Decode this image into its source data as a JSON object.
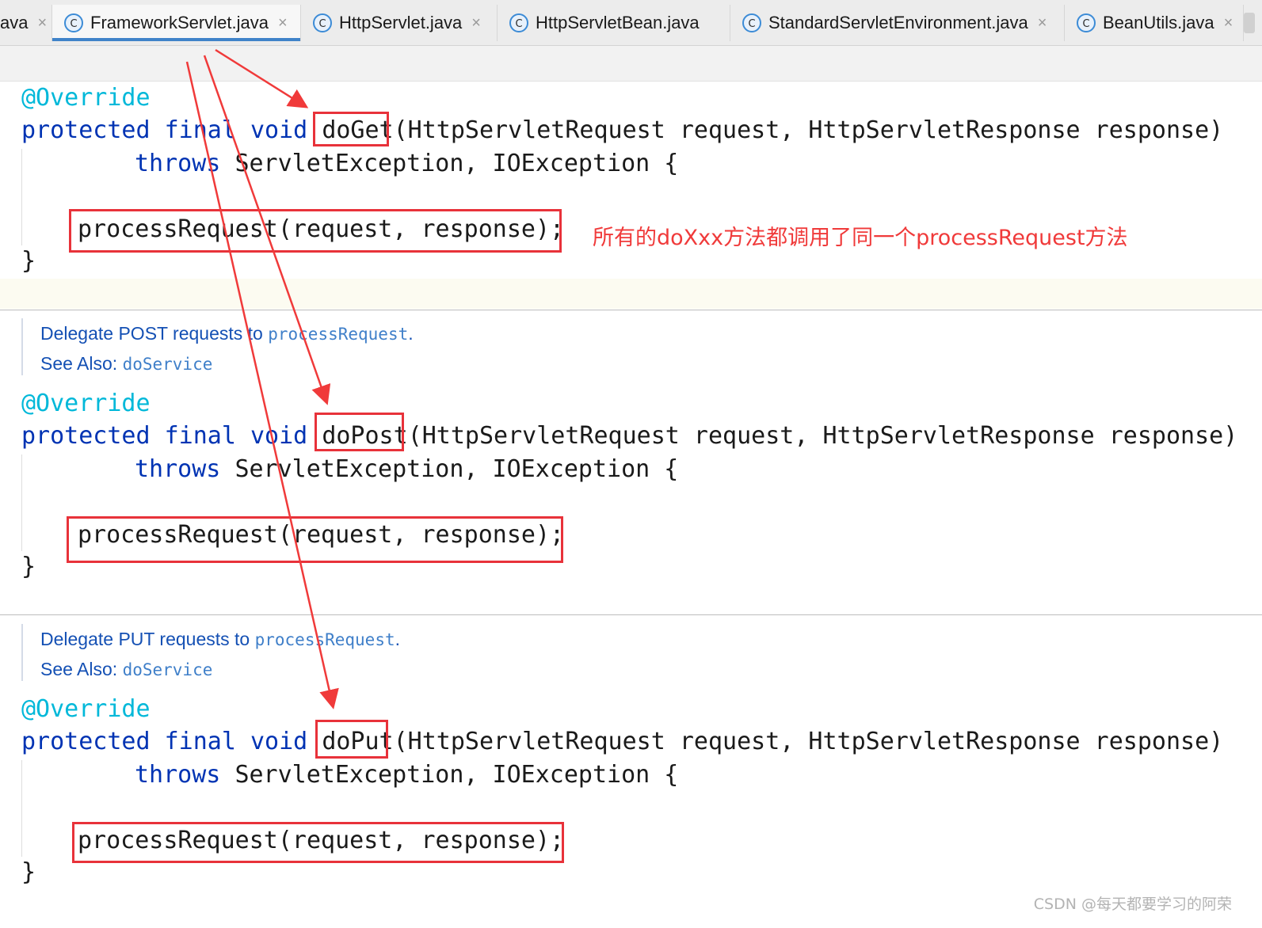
{
  "tabs": [
    {
      "label": "ava",
      "active": false,
      "partial": true
    },
    {
      "label": "FrameworkServlet.java",
      "active": true
    },
    {
      "label": "HttpServlet.java",
      "active": false
    },
    {
      "label": "HttpServletBean.java",
      "active": false
    },
    {
      "label": "StandardServletEnvironment.java",
      "active": false
    },
    {
      "label": "BeanUtils.java",
      "active": false
    }
  ],
  "close_glyph": "×",
  "class_icon_letter": "C",
  "code": {
    "annotation": "@Override",
    "kw_protected": "protected",
    "kw_final": "final",
    "kw_void": "void",
    "kw_throws": "throws",
    "params": "(HttpServletRequest request, HttpServletResponse response)",
    "exceptions": "ServletException, IOException {",
    "call": "processRequest(request, response);",
    "close_brace": "}"
  },
  "methods": [
    {
      "name": "doGet",
      "doc": null
    },
    {
      "name": "doPost",
      "doc": {
        "text": "Delegate POST requests to ",
        "code": "processRequest",
        "end": ".",
        "see_also_label": "See Also: ",
        "see_also_code": "doService"
      }
    },
    {
      "name": "doPut",
      "doc": {
        "text": "Delegate PUT requests to ",
        "code": "processRequest",
        "end": ".",
        "see_also_label": "See Also: ",
        "see_also_code": "doService"
      }
    }
  ],
  "annotation_note": "所有的doXxx方法都调用了同一个processRequest方法",
  "watermark": "CSDN @每天都要学习的阿荣",
  "colors": {
    "keyword": "#0033b3",
    "annotation": "#00b8d9",
    "highlight_box": "#e8323a",
    "arrow": "#f03a3a",
    "active_tab_underline": "#4083c9"
  }
}
